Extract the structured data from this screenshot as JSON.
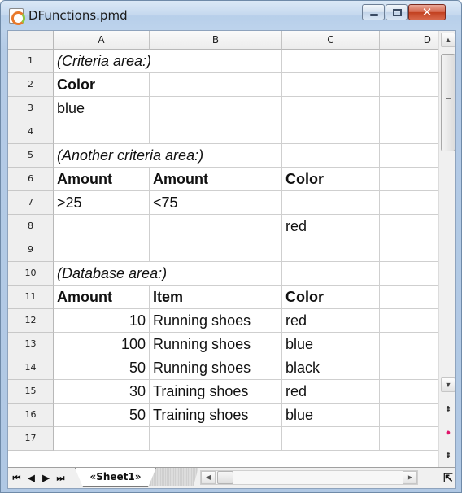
{
  "window": {
    "title": "DFunctions.pmd",
    "close_label": "✕"
  },
  "columns": [
    "A",
    "B",
    "C",
    "D"
  ],
  "rows": [
    {
      "n": "1",
      "a": "(Criteria area:)",
      "b": "",
      "c": ""
    },
    {
      "n": "2",
      "a": "Color",
      "b": "",
      "c": ""
    },
    {
      "n": "3",
      "a": "blue",
      "b": "",
      "c": ""
    },
    {
      "n": "4",
      "a": "",
      "b": "",
      "c": ""
    },
    {
      "n": "5",
      "a": "(Another criteria area:)",
      "b": "",
      "c": ""
    },
    {
      "n": "6",
      "a": "Amount",
      "b": "Amount",
      "c": "Color"
    },
    {
      "n": "7",
      "a": ">25",
      "b": "<75",
      "c": ""
    },
    {
      "n": "8",
      "a": "",
      "b": "",
      "c": "red"
    },
    {
      "n": "9",
      "a": "",
      "b": "",
      "c": ""
    },
    {
      "n": "10",
      "a": "(Database area:)",
      "b": "",
      "c": ""
    },
    {
      "n": "11",
      "a": "Amount",
      "b": "Item",
      "c": "Color"
    },
    {
      "n": "12",
      "a": "10",
      "b": "Running shoes",
      "c": "red"
    },
    {
      "n": "13",
      "a": "100",
      "b": "Running shoes",
      "c": "blue"
    },
    {
      "n": "14",
      "a": "50",
      "b": "Running shoes",
      "c": "black"
    },
    {
      "n": "15",
      "a": "30",
      "b": "Training shoes",
      "c": "red"
    },
    {
      "n": "16",
      "a": "50",
      "b": "Training shoes",
      "c": "blue"
    },
    {
      "n": "17",
      "a": "",
      "b": "",
      "c": ""
    }
  ],
  "tabs": {
    "nav_first": "⏮",
    "nav_prev": "◀",
    "nav_next": "▶",
    "nav_last": "⏭",
    "active_sheet": "«Sheet1»"
  },
  "scroll": {
    "up": "▲",
    "down": "▼",
    "left": "◀",
    "right": "▶",
    "page_up": "⇞",
    "page_down": "⇟",
    "nav_dot": "●",
    "corner": "⇱"
  },
  "icons": [
    "app-icon",
    "minimize-icon",
    "maximize-icon",
    "close-icon",
    "scroll-up-icon",
    "scroll-down-icon"
  ]
}
